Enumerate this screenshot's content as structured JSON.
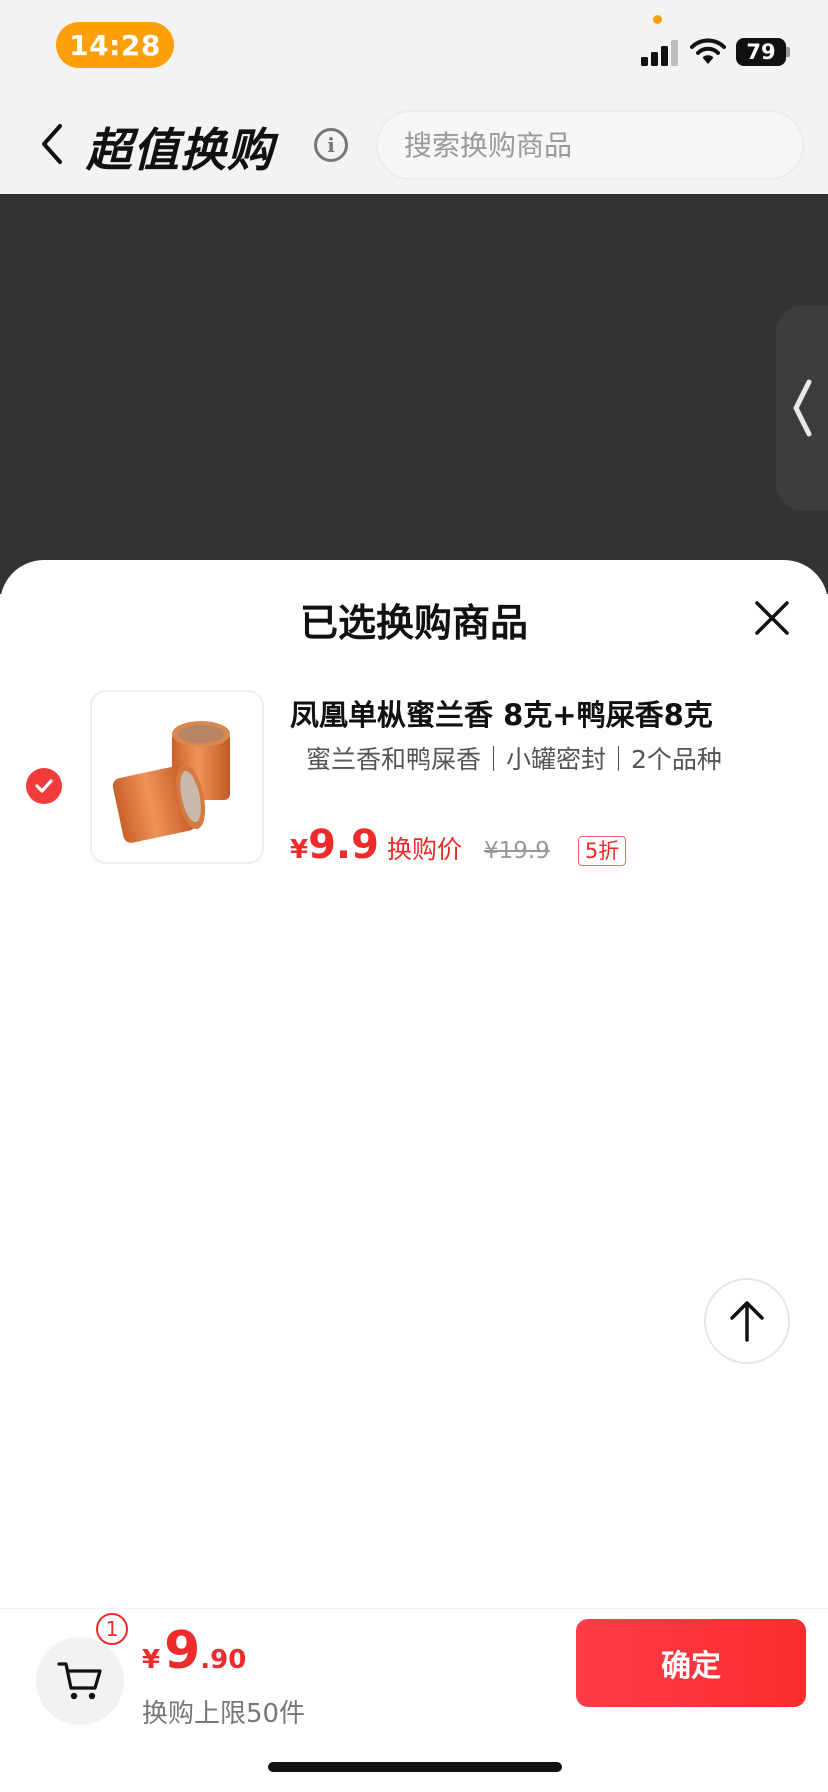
{
  "status_bar": {
    "time": "14:28",
    "battery": "79",
    "signal_icon": "cellular-signal-icon",
    "wifi_icon": "wifi-icon"
  },
  "header": {
    "title": "超值换购",
    "search_placeholder": "搜索换购商品",
    "back_icon": "chevron-left-icon",
    "info_icon": "info-icon"
  },
  "side_tab": {
    "icon": "chevron-left-icon"
  },
  "sheet": {
    "title": "已选换购商品",
    "close_icon": "close-icon",
    "items": [
      {
        "selected": true,
        "name": "凤凰单枞蜜兰香 8克+鸭屎香8克",
        "spec": "蜜兰香和鸭屎香｜小罐密封｜2个品种",
        "currency": "¥",
        "price": "9.9",
        "price_label": "换购价",
        "original_price": "¥19.9",
        "discount": "5折"
      }
    ]
  },
  "scroll_top": {
    "icon": "arrow-up-icon"
  },
  "bottom_bar": {
    "cart_icon": "cart-icon",
    "cart_count": "1",
    "currency": "¥",
    "total_int": "9",
    "total_dec": ".90",
    "limit_text": "换购上限50件",
    "confirm_label": "确定"
  },
  "colors": {
    "accent": "#ee2b2b",
    "time_pill": "#ff9f0a",
    "overlay": "#333333"
  }
}
